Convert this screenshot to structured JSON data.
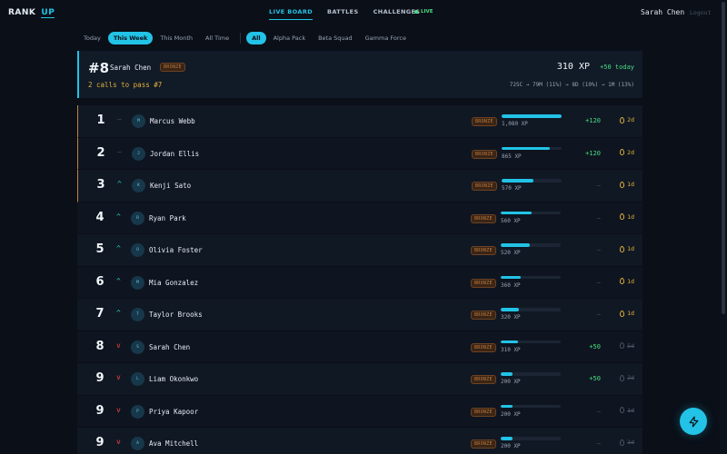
{
  "brand": {
    "name": "RANK",
    "accent": "UP"
  },
  "nav": {
    "links": [
      {
        "label": "LIVE BOARD",
        "active": true
      },
      {
        "label": "BATTLES",
        "active": false
      },
      {
        "label": "CHALLENGES",
        "active": false
      }
    ],
    "live_label": "LIVE",
    "user_name": "Sarah Chen",
    "logout_label": "Logout"
  },
  "filters": {
    "time": [
      "Today",
      "This Week",
      "This Month",
      "All Time"
    ],
    "time_active": "This Week",
    "teams": [
      "All",
      "Alpha Pack",
      "Beta Squad",
      "Gamma Force"
    ],
    "team_active": "All"
  },
  "me": {
    "rank": "#8",
    "name": "Sarah Chen",
    "tier": "BRONZE",
    "gap_text": "2 calls to pass #7",
    "xp": "310 XP",
    "today": "+50 today",
    "progression": "725C → 79M (11%) → 8D (10%) → 1M (13%)"
  },
  "rows": [
    {
      "rank": "1",
      "move": "—",
      "dir": "same",
      "initial": "M",
      "name": "Marcus Webb",
      "tier": "BRONZE",
      "xp": "1,080 XP",
      "pct": 100,
      "delta": "+120",
      "streak": "2d",
      "streak_active": true
    },
    {
      "rank": "2",
      "move": "—",
      "dir": "same",
      "initial": "J",
      "name": "Jordan Ellis",
      "tier": "BRONZE",
      "xp": "865 XP",
      "pct": 80,
      "delta": "+120",
      "streak": "2d",
      "streak_active": true
    },
    {
      "rank": "3",
      "move": "^",
      "dir": "up",
      "initial": "K",
      "name": "Kenji Sato",
      "tier": "BRONZE",
      "xp": "570 XP",
      "pct": 53,
      "delta": "—",
      "streak": "1d",
      "streak_active": true
    },
    {
      "rank": "4",
      "move": "^",
      "dir": "up",
      "initial": "R",
      "name": "Ryan Park",
      "tier": "BRONZE",
      "xp": "560 XP",
      "pct": 52,
      "delta": "—",
      "streak": "1d",
      "streak_active": true
    },
    {
      "rank": "5",
      "move": "^",
      "dir": "up",
      "initial": "O",
      "name": "Olivia Foster",
      "tier": "BRONZE",
      "xp": "520 XP",
      "pct": 48,
      "delta": "—",
      "streak": "1d",
      "streak_active": true
    },
    {
      "rank": "6",
      "move": "^",
      "dir": "up",
      "initial": "M",
      "name": "Mia Gonzalez",
      "tier": "BRONZE",
      "xp": "360 XP",
      "pct": 33,
      "delta": "—",
      "streak": "1d",
      "streak_active": true
    },
    {
      "rank": "7",
      "move": "^",
      "dir": "up",
      "initial": "T",
      "name": "Taylor Brooks",
      "tier": "BRONZE",
      "xp": "320 XP",
      "pct": 30,
      "delta": "—",
      "streak": "1d",
      "streak_active": true
    },
    {
      "rank": "8",
      "move": "v",
      "dir": "down",
      "initial": "S",
      "name": "Sarah Chen",
      "tier": "BRONZE",
      "xp": "310 XP",
      "pct": 29,
      "delta": "+50",
      "streak": "5d",
      "streak_active": false
    },
    {
      "rank": "9",
      "move": "v",
      "dir": "down",
      "initial": "L",
      "name": "Liam Okonkwo",
      "tier": "BRONZE",
      "xp": "200 XP",
      "pct": 19,
      "delta": "+50",
      "streak": "2d",
      "streak_active": false
    },
    {
      "rank": "9",
      "move": "v",
      "dir": "down",
      "initial": "P",
      "name": "Priya Kapoor",
      "tier": "BRONZE",
      "xp": "200 XP",
      "pct": 19,
      "delta": "—",
      "streak": "1d",
      "streak_active": false
    },
    {
      "rank": "9",
      "move": "v",
      "dir": "down",
      "initial": "A",
      "name": "Ava Mitchell",
      "tier": "BRONZE",
      "xp": "200 XP",
      "pct": 19,
      "delta": "—",
      "streak": "1d",
      "streak_active": false
    }
  ],
  "icons": {
    "fab": "lightning-icon",
    "streak": "flame-icon"
  },
  "colors": {
    "accent": "#22c3e6",
    "positive": "#4ade80",
    "negative": "#ef4444",
    "bronze": "#c07a3c",
    "gold": "#e3b13a"
  }
}
